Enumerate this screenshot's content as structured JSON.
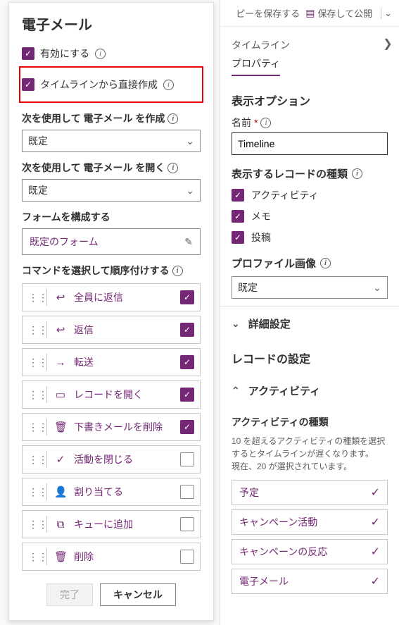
{
  "topbar": {
    "save_copy": "ピーを保存する",
    "save_publish": "保存して公開"
  },
  "left": {
    "title": "電子メール",
    "enable": "有効にする",
    "create_from_timeline": "タイムラインから直接作成",
    "create_using_label": "次を使用して 電子メール を作成",
    "create_using_value": "既定",
    "open_using_label": "次を使用して 電子メール を開く",
    "open_using_value": "既定",
    "configure_form_label": "フォームを構成する",
    "configure_form_value": "既定のフォーム",
    "commands_label": "コマンドを選択して順序付けする",
    "commands": [
      {
        "icon": "↩",
        "label": "全員に返信",
        "checked": true
      },
      {
        "icon": "↩",
        "label": "返信",
        "checked": true
      },
      {
        "icon": "→",
        "label": "転送",
        "checked": true
      },
      {
        "icon": "▭",
        "label": "レコードを開く",
        "checked": true
      },
      {
        "icon": "🗑",
        "label": "下書きメールを削除",
        "checked": true
      },
      {
        "icon": "✓",
        "label": "活動を閉じる",
        "checked": false
      },
      {
        "icon": "👤",
        "label": "割り当てる",
        "checked": false
      },
      {
        "icon": "⧉",
        "label": "キューに追加",
        "checked": false
      },
      {
        "icon": "🗑",
        "label": "削除",
        "checked": false
      }
    ],
    "done": "完了",
    "cancel": "キャンセル"
  },
  "right": {
    "tab_timeline": "タイムライン",
    "tab_properties": "プロパティ",
    "display_options": "表示オプション",
    "name_label": "名前",
    "name_value": "Timeline",
    "record_types_label": "表示するレコードの種類",
    "record_types": [
      {
        "label": "アクティビティ",
        "checked": true
      },
      {
        "label": "メモ",
        "checked": true
      },
      {
        "label": "投稿",
        "checked": true
      }
    ],
    "profile_image_label": "プロファイル画像",
    "profile_image_value": "既定",
    "advanced": "詳細設定",
    "record_settings": "レコードの設定",
    "activity": "アクティビティ",
    "activity_types": "アクティビティの種類",
    "activity_warning": "10 を超えるアクティビティの種類を選択するとタイムラインが遅くなります。\n現在、20 が選択されています。",
    "activities": [
      "予定",
      "キャンペーン活動",
      "キャンペーンの反応",
      "電子メール"
    ]
  }
}
